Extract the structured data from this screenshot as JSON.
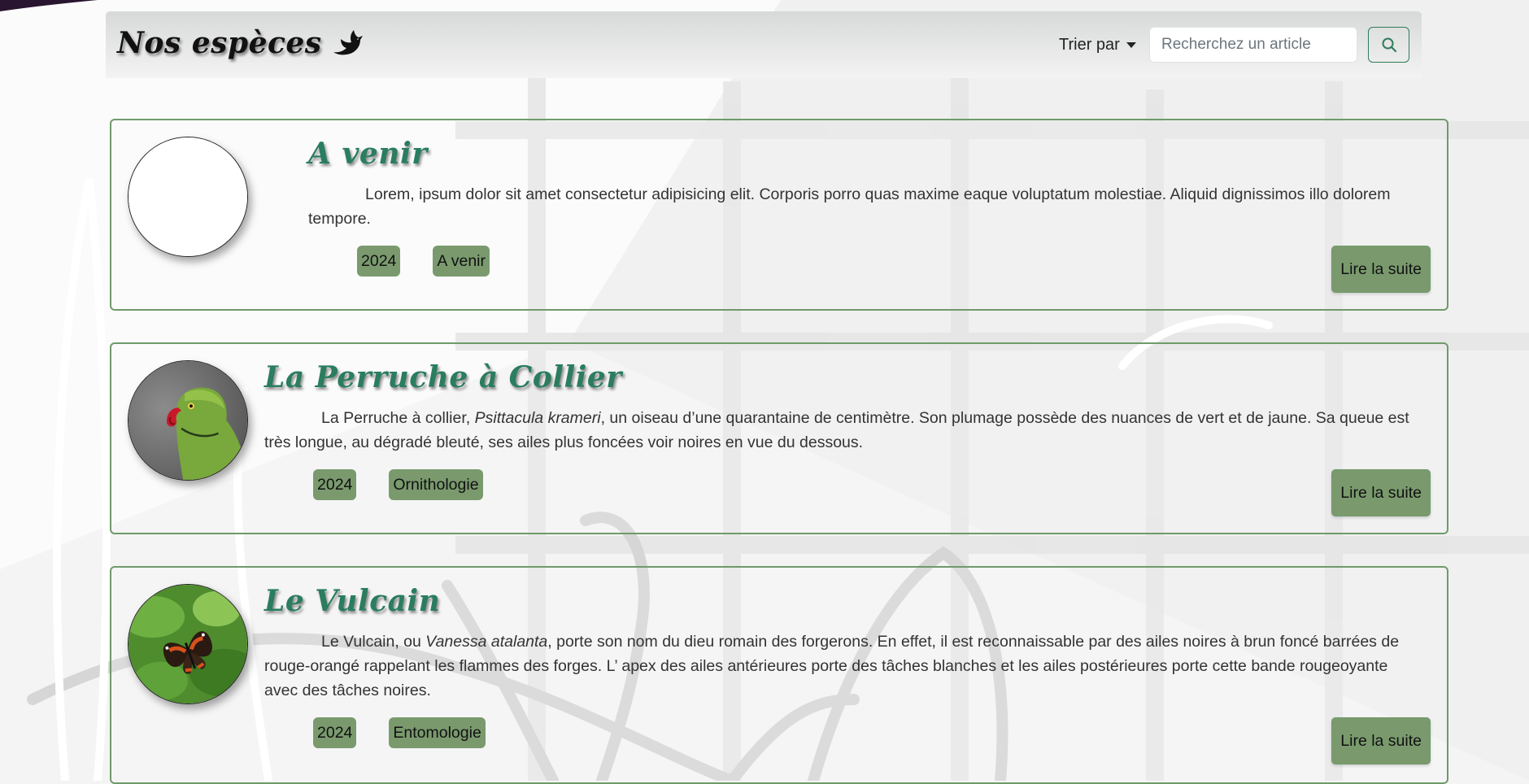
{
  "colors": {
    "accent": "#2a7d5f",
    "tag_bg": "#7a9a6e",
    "card_border": "#6f9a6a"
  },
  "navbar": {
    "brand": "Nos espèces",
    "brand_icon": "dove-icon",
    "sort_label": "Trier par",
    "search_placeholder": "Recherchez un article",
    "search_icon": "search-icon"
  },
  "articles": [
    {
      "title": "A venir",
      "text_parts": [
        "Lorem, ipsum dolor sit amet consectetur adipisicing elit. Corporis porro quas maxime eaque voluptatum molestiae. Aliquid dignissimos illo dolorem tempore.",
        "",
        ""
      ],
      "year": "2024",
      "category": "A venir",
      "button": "Lire la suite",
      "image": "empty-placeholder"
    },
    {
      "title": "La Perruche à Collier",
      "text_parts": [
        "La Perruche à collier, ",
        "Psittacula krameri",
        ", un oiseau d’une quarantaine de centimètre. Son plumage possède des nuances de vert et de jaune. Sa queue est très longue, au dégradé bleuté, ses ailes plus foncées voir noires en vue du dessous."
      ],
      "year": "2024",
      "category": "Ornithologie",
      "button": "Lire la suite",
      "image": "parakeet-photo"
    },
    {
      "title": "Le Vulcain",
      "text_parts": [
        "Le Vulcain, ou ",
        "Vanessa atalanta",
        ", porte son nom du dieu romain des forgerons. En effet, il est reconnaissable par des ailes noires à brun foncé barrées de rouge-orangé rappelant les flammes des forges. L’ apex des ailes antérieures porte des tâches blanches et les ailes postérieures porte cette bande rougeoyante avec des tâches noires."
      ],
      "year": "2024",
      "category": "Entomologie",
      "button": "Lire la suite",
      "image": "butterfly-photo"
    }
  ]
}
